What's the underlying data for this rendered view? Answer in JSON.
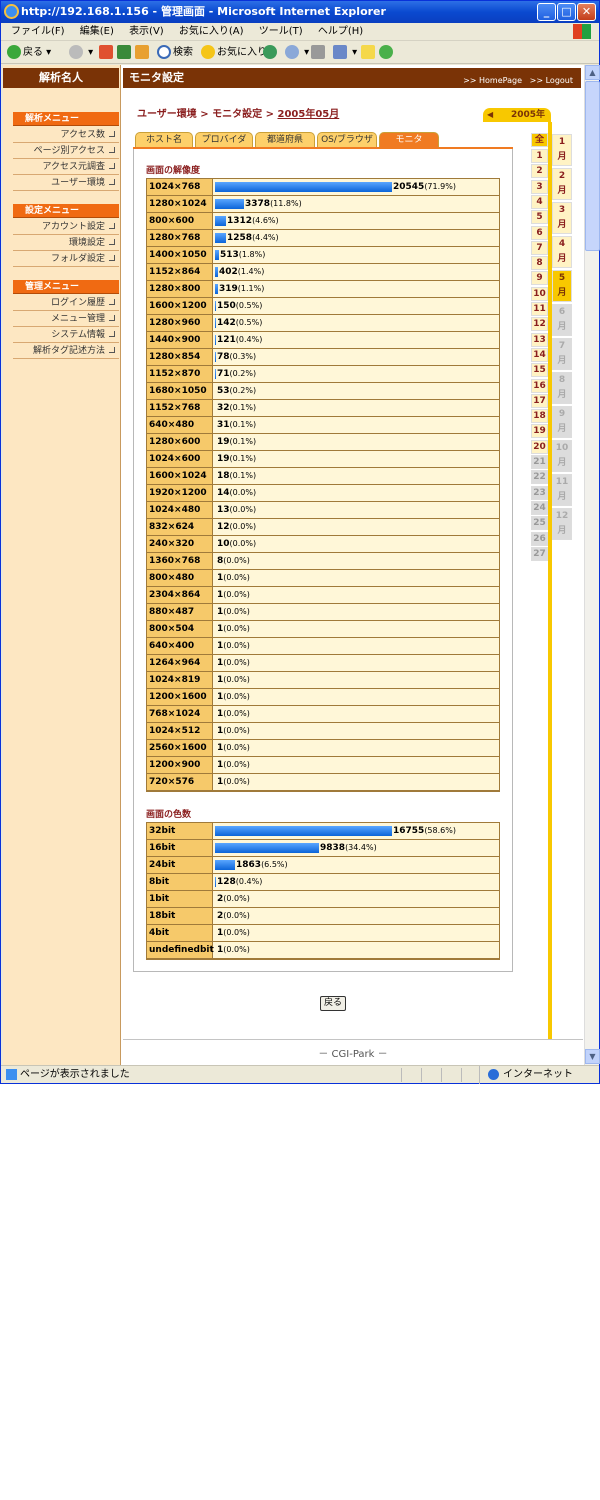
{
  "window": {
    "title": "http://192.168.1.156 - 管理画面 - Microsoft Internet Explorer",
    "menu": [
      "ファイル(F)",
      "編集(E)",
      "表示(V)",
      "お気に入り(A)",
      "ツール(T)",
      "ヘルプ(H)"
    ],
    "toolbar": {
      "back": "戻る",
      "search": "検索",
      "favorites": "お気に入り"
    },
    "status": {
      "text": "ページが表示されました",
      "zone": "インターネット"
    }
  },
  "sidebar": {
    "logo": "解析名人",
    "sections": [
      {
        "title": "解析メニュー",
        "items": [
          "アクセス数",
          "ページ別アクセス",
          "アクセス元調査",
          "ユーザー環境"
        ]
      },
      {
        "title": "設定メニュー",
        "items": [
          "アカウント設定",
          "環境設定",
          "フォルダ設定"
        ]
      },
      {
        "title": "管理メニュー",
        "items": [
          "ログイン履歴",
          "メニュー管理",
          "システム情報",
          "解析タグ記述方法"
        ]
      }
    ]
  },
  "header": {
    "title": "モニタ設定",
    "link_home": ">> HomePage",
    "link_logout": ">> Logout"
  },
  "breadcrumb": {
    "a": "ユーザー環境",
    "sep1": " > ",
    "b": "モニタ設定",
    "sep2": " > ",
    "c": "2005年05月"
  },
  "tabs": [
    {
      "label": "ホスト名",
      "active": false
    },
    {
      "label": "プロバイダ",
      "active": false
    },
    {
      "label": "都道府県",
      "active": false
    },
    {
      "label": "OS/ブラウザ",
      "active": false
    },
    {
      "label": "モニタ",
      "active": true
    }
  ],
  "resolution": {
    "title": "画面の解像度",
    "max": 20545,
    "rows": [
      {
        "label": "1024×768",
        "count": 20545,
        "pct": "(71.9%)"
      },
      {
        "label": "1280×1024",
        "count": 3378,
        "pct": "(11.8%)"
      },
      {
        "label": "800×600",
        "count": 1312,
        "pct": "(4.6%)"
      },
      {
        "label": "1280×768",
        "count": 1258,
        "pct": "(4.4%)"
      },
      {
        "label": "1400×1050",
        "count": 513,
        "pct": "(1.8%)"
      },
      {
        "label": "1152×864",
        "count": 402,
        "pct": "(1.4%)"
      },
      {
        "label": "1280×800",
        "count": 319,
        "pct": "(1.1%)"
      },
      {
        "label": "1600×1200",
        "count": 150,
        "pct": "(0.5%)"
      },
      {
        "label": "1280×960",
        "count": 142,
        "pct": "(0.5%)"
      },
      {
        "label": "1440×900",
        "count": 121,
        "pct": "(0.4%)"
      },
      {
        "label": "1280×854",
        "count": 78,
        "pct": "(0.3%)"
      },
      {
        "label": "1152×870",
        "count": 71,
        "pct": "(0.2%)"
      },
      {
        "label": "1680×1050",
        "count": 53,
        "pct": "(0.2%)"
      },
      {
        "label": "1152×768",
        "count": 32,
        "pct": "(0.1%)"
      },
      {
        "label": "640×480",
        "count": 31,
        "pct": "(0.1%)"
      },
      {
        "label": "1280×600",
        "count": 19,
        "pct": "(0.1%)"
      },
      {
        "label": "1024×600",
        "count": 19,
        "pct": "(0.1%)"
      },
      {
        "label": "1600×1024",
        "count": 18,
        "pct": "(0.1%)"
      },
      {
        "label": "1920×1200",
        "count": 14,
        "pct": "(0.0%)"
      },
      {
        "label": "1024×480",
        "count": 13,
        "pct": "(0.0%)"
      },
      {
        "label": "832×624",
        "count": 12,
        "pct": "(0.0%)"
      },
      {
        "label": "240×320",
        "count": 10,
        "pct": "(0.0%)"
      },
      {
        "label": "1360×768",
        "count": 8,
        "pct": "(0.0%)"
      },
      {
        "label": "800×480",
        "count": 1,
        "pct": "(0.0%)"
      },
      {
        "label": "2304×864",
        "count": 1,
        "pct": "(0.0%)"
      },
      {
        "label": "880×487",
        "count": 1,
        "pct": "(0.0%)"
      },
      {
        "label": "800×504",
        "count": 1,
        "pct": "(0.0%)"
      },
      {
        "label": "640×400",
        "count": 1,
        "pct": "(0.0%)"
      },
      {
        "label": "1264×964",
        "count": 1,
        "pct": "(0.0%)"
      },
      {
        "label": "1024×819",
        "count": 1,
        "pct": "(0.0%)"
      },
      {
        "label": "1200×1600",
        "count": 1,
        "pct": "(0.0%)"
      },
      {
        "label": "768×1024",
        "count": 1,
        "pct": "(0.0%)"
      },
      {
        "label": "1024×512",
        "count": 1,
        "pct": "(0.0%)"
      },
      {
        "label": "2560×1600",
        "count": 1,
        "pct": "(0.0%)"
      },
      {
        "label": "1200×900",
        "count": 1,
        "pct": "(0.0%)"
      },
      {
        "label": "720×576",
        "count": 1,
        "pct": "(0.0%)"
      }
    ]
  },
  "colors": {
    "title": "画面の色数",
    "max": 16755,
    "rows": [
      {
        "label": "32bit",
        "count": 16755,
        "pct": "(58.6%)"
      },
      {
        "label": "16bit",
        "count": 9838,
        "pct": "(34.4%)"
      },
      {
        "label": "24bit",
        "count": 1863,
        "pct": "(6.5%)"
      },
      {
        "label": "8bit",
        "count": 128,
        "pct": "(0.4%)"
      },
      {
        "label": "1bit",
        "count": 2,
        "pct": "(0.0%)"
      },
      {
        "label": "18bit",
        "count": 2,
        "pct": "(0.0%)"
      },
      {
        "label": "4bit",
        "count": 1,
        "pct": "(0.0%)"
      },
      {
        "label": "undefinedbit",
        "count": 1,
        "pct": "(0.0%)"
      }
    ]
  },
  "back_button": "戻る",
  "footer": "－ CGI-Park －",
  "calendar": {
    "year": "2005年",
    "all": "全",
    "days": [
      "1",
      "2",
      "3",
      "4",
      "5",
      "6",
      "7",
      "8",
      "9",
      "10",
      "11",
      "12",
      "13",
      "14",
      "15",
      "16",
      "17",
      "18",
      "19",
      "20",
      "21",
      "22",
      "23",
      "24",
      "25",
      "26",
      "27"
    ],
    "days_active_until": 20,
    "months": [
      [
        "1",
        "月"
      ],
      [
        "2",
        "月"
      ],
      [
        "3",
        "月"
      ],
      [
        "4",
        "月"
      ],
      [
        "5",
        "月"
      ],
      [
        "6",
        "月"
      ],
      [
        "7",
        "月"
      ],
      [
        "8",
        "月"
      ],
      [
        "9",
        "月"
      ],
      [
        "10",
        "月"
      ],
      [
        "11",
        "月"
      ],
      [
        "12",
        "月"
      ]
    ],
    "current_month": 5
  },
  "chart_data": [
    {
      "type": "bar",
      "title": "画面の解像度",
      "categories": [
        "1024×768",
        "1280×1024",
        "800×600",
        "1280×768",
        "1400×1050",
        "1152×864",
        "1280×800",
        "1600×1200",
        "1280×960",
        "1440×900",
        "1280×854",
        "1152×870",
        "1680×1050",
        "1152×768",
        "640×480",
        "1280×600",
        "1024×600",
        "1600×1024",
        "1920×1200",
        "1024×480",
        "832×624",
        "240×320",
        "1360×768",
        "800×480",
        "2304×864",
        "880×487",
        "800×504",
        "640×400",
        "1264×964",
        "1024×819",
        "1200×1600",
        "768×1024",
        "1024×512",
        "2560×1600",
        "1200×900",
        "720×576"
      ],
      "values": [
        20545,
        3378,
        1312,
        1258,
        513,
        402,
        319,
        150,
        142,
        121,
        78,
        71,
        53,
        32,
        31,
        19,
        19,
        18,
        14,
        13,
        12,
        10,
        8,
        1,
        1,
        1,
        1,
        1,
        1,
        1,
        1,
        1,
        1,
        1,
        1,
        1
      ]
    },
    {
      "type": "bar",
      "title": "画面の色数",
      "categories": [
        "32bit",
        "16bit",
        "24bit",
        "8bit",
        "1bit",
        "18bit",
        "4bit",
        "undefinedbit"
      ],
      "values": [
        16755,
        9838,
        1863,
        128,
        2,
        2,
        1,
        1
      ]
    }
  ]
}
